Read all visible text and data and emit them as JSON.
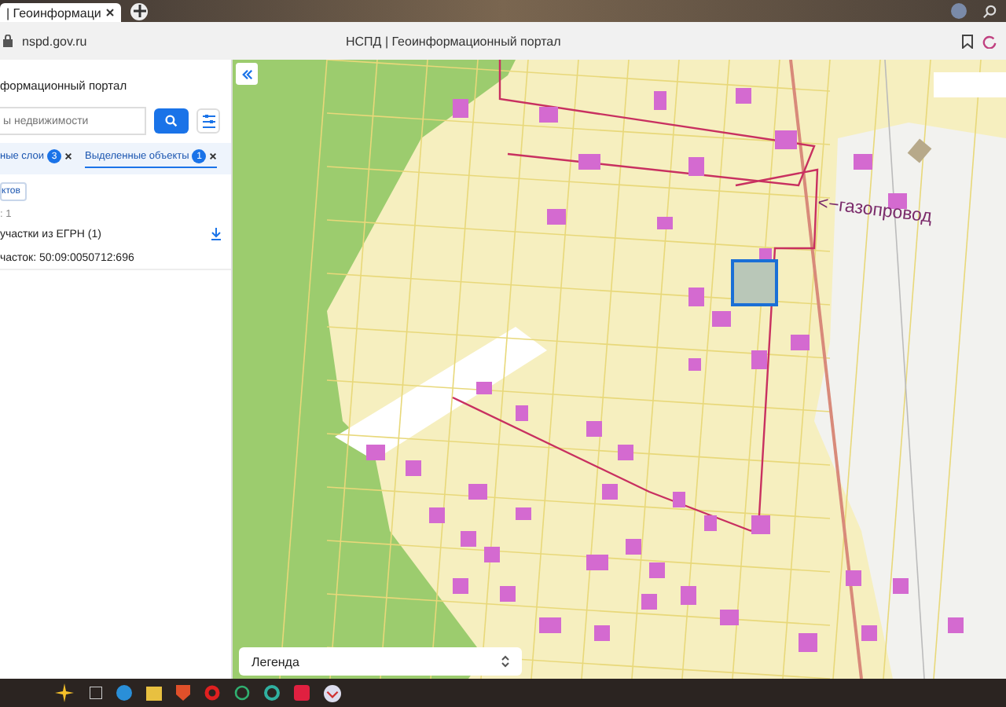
{
  "browser": {
    "tab": {
      "title": "| Геоинформаци",
      "selected": true
    },
    "address": "nspd.gov.ru",
    "page_title": "НСПД | Геоинформационный портал"
  },
  "panel": {
    "title": "формационный портал",
    "search": {
      "placeholder": "ы недвижимости"
    },
    "tabs": [
      {
        "label": "ные слои",
        "count": "3",
        "selected": false
      },
      {
        "label": "Выделенные объекты",
        "count": "1",
        "selected": true
      }
    ],
    "chip": "ктов",
    "count_text": ": 1",
    "section": "участки из ЕГРН (1)",
    "parcel": "часток: 50:09:0050712:696"
  },
  "map": {
    "annotation": "<−газопровод",
    "legend": "Легенда"
  }
}
